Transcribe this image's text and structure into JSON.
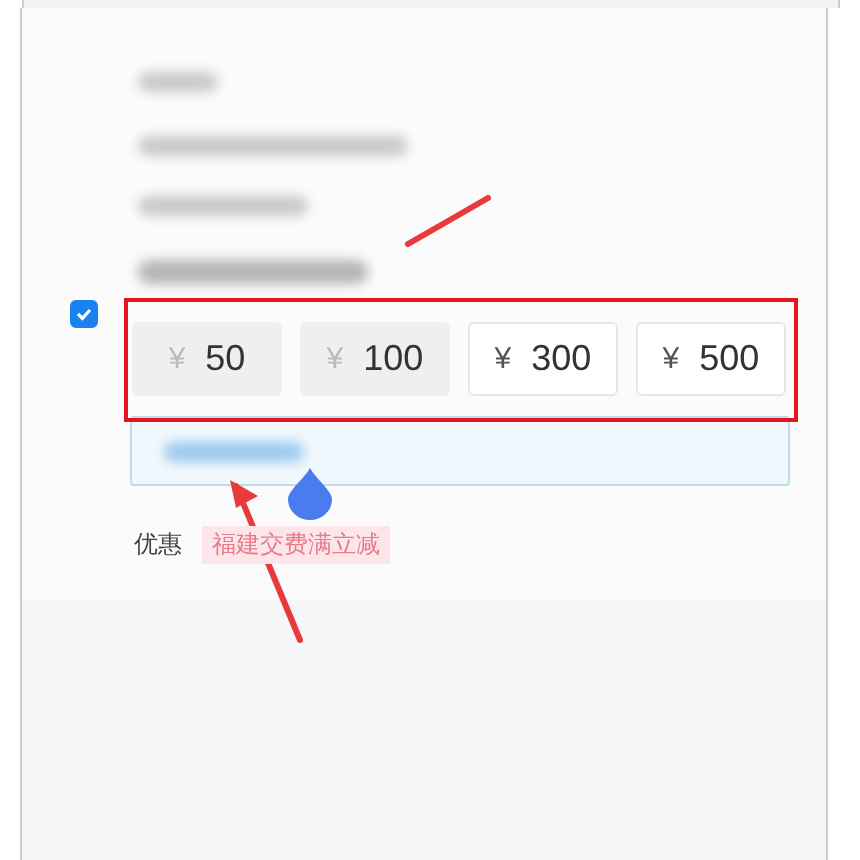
{
  "checkbox": {
    "checked": true
  },
  "amounts": [
    {
      "currency": "¥",
      "value": "50",
      "disabled": true
    },
    {
      "currency": "¥",
      "value": "100",
      "disabled": true
    },
    {
      "currency": "¥",
      "value": "300",
      "disabled": false
    },
    {
      "currency": "¥",
      "value": "500",
      "disabled": false
    }
  ],
  "discount": {
    "label": "优惠",
    "tag": "福建交费满立减"
  }
}
